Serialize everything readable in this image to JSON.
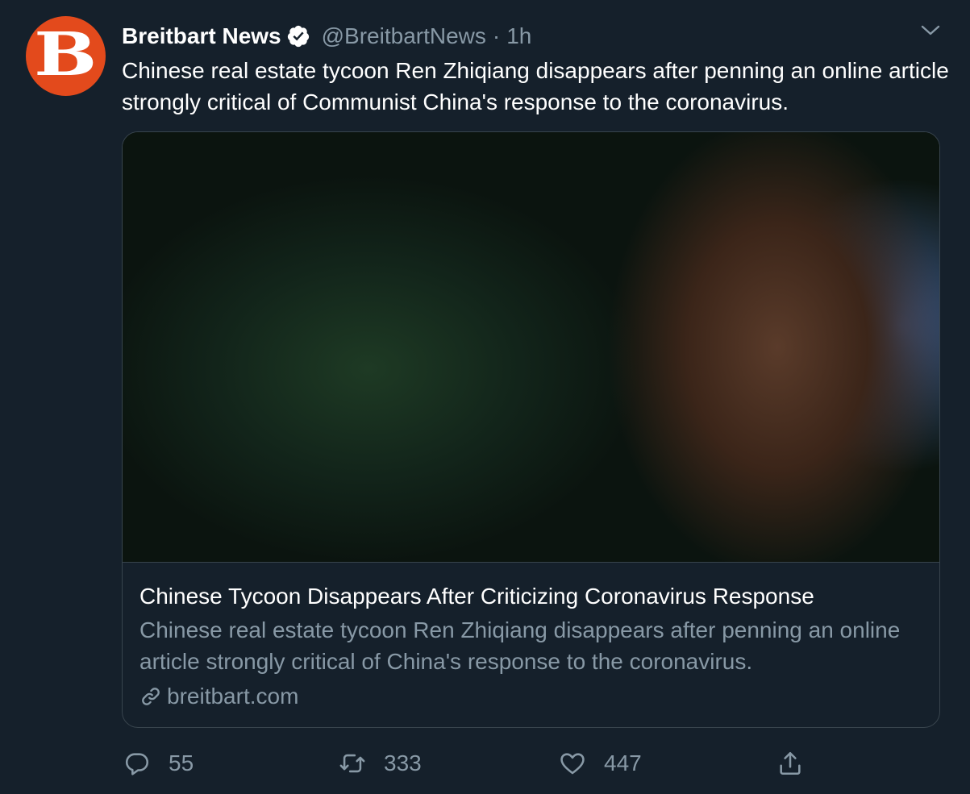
{
  "author": {
    "avatar_letter": "B",
    "display_name": "Breitbart News",
    "handle": "@BreitbartNews",
    "separator": "·",
    "time": "1h",
    "verified": true
  },
  "tweet": {
    "text": "Chinese real estate tycoon Ren Zhiqiang disappears after penning an online article strongly critical of Communist China's response to the coronavirus."
  },
  "card": {
    "title": "Chinese Tycoon Disappears After Criticizing Coronavirus Response",
    "description": "Chinese real estate tycoon Ren Zhiqiang disappears after penning an online article strongly critical of China's response to the coronavirus.",
    "domain": "breitbart.com"
  },
  "actions": {
    "reply_count": "55",
    "retweet_count": "333",
    "like_count": "447"
  },
  "icons": {
    "verified": "verified-badge-icon",
    "caret": "chevron-down-icon",
    "link": "link-icon",
    "reply": "reply-icon",
    "retweet": "retweet-icon",
    "like": "heart-icon",
    "share": "share-icon"
  },
  "colors": {
    "background": "#15202b",
    "border": "#38444d",
    "secondary_text": "#8899a6",
    "avatar_brand": "#e34a1c"
  }
}
